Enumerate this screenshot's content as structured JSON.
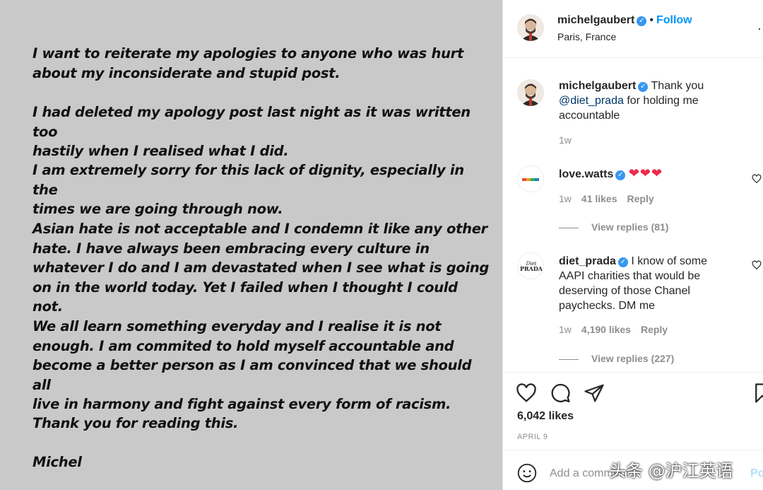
{
  "post_image": {
    "paragraphs": [
      "I want to reiterate my apologies to anyone who was hurt\nabout my inconsiderate and stupid post.",
      "I had deleted my apology post last night as it was written too\nhastily when I realised what I did.",
      "I am extremely sorry for this lack of dignity, especially in the\ntimes we are going through now.",
      "Asian hate is not acceptable and I condemn it like any other\nhate. I have always been embracing  every culture in\nwhatever I do and  I am devastated when I see what is going\non in the world today. Yet I failed when I thought I could not.",
      "We all learn something everyday and I realise it is not\nenough. I am commited to hold myself accountable and\nbecome a better person as I am convinced that we should all\nlive in harmony and fight against every form of racism.",
      "Thank you for reading this.",
      "Michel"
    ]
  },
  "header": {
    "username": "michelgaubert",
    "dot": "•",
    "follow_label": "Follow",
    "location": "Paris, France",
    "more": "···"
  },
  "comments": [
    {
      "username": "michelgaubert",
      "text_before": "Thank you",
      "mention": "@diet_prada",
      "text_after": "for holding me accountable",
      "time": "1w"
    },
    {
      "username": "love.watts",
      "text": "❤❤❤",
      "time": "1w",
      "likes": "41 likes",
      "reply": "Reply",
      "view_replies": "View replies (81)"
    },
    {
      "username": "diet_prada",
      "text": "I know of some AAPI charities that would be deserving of those Chanel paychecks. DM me",
      "time": "1w",
      "likes": "4,190 likes",
      "reply": "Reply",
      "view_replies": "View replies (227)",
      "avatar_text": "Diet PRADA"
    }
  ],
  "actions": {
    "likes": "6,042 likes",
    "date": "APRIL 9",
    "icons": [
      "heart-icon",
      "comment-icon",
      "share-icon",
      "bookmark-icon"
    ]
  },
  "add_comment": {
    "placeholder": "Add a comment...",
    "post_label": "Post"
  },
  "watermark": "头条 @沪江英语",
  "colors": {
    "image_bg": "#c9c9c9",
    "link": "#0095f6",
    "mention": "#00376b",
    "verified": "#3897f0",
    "hearts": "#ed2b4b",
    "meta": "#8e8e8e"
  }
}
